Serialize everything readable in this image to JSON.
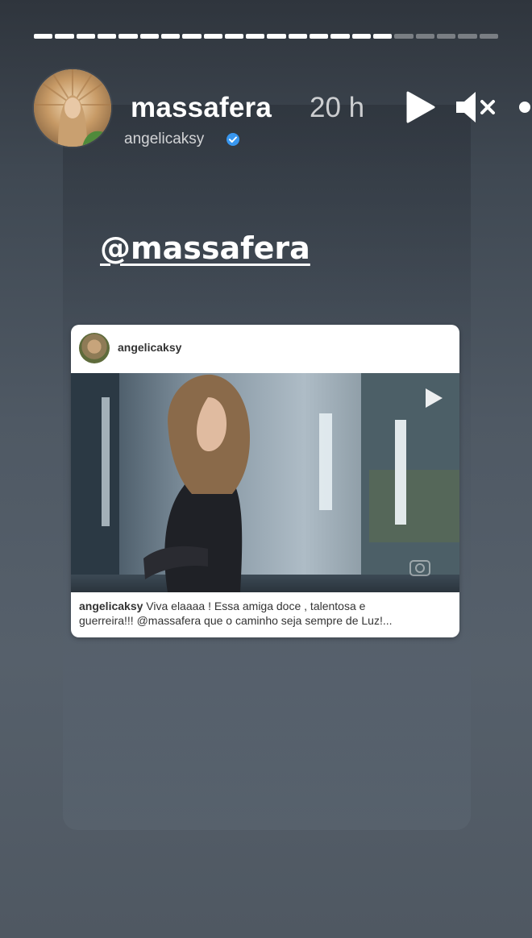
{
  "progress": {
    "segments": 22,
    "completed": 17
  },
  "header": {
    "username": "massafera",
    "time": "20 h",
    "sub_username": "angelicaksy",
    "icons": [
      "play-icon",
      "mute-icon",
      "more-icon",
      "verified-icon"
    ]
  },
  "story": {
    "mention": "@massafera"
  },
  "post": {
    "username": "angelicaksy",
    "caption_user": "angelicaksy",
    "caption_line1": "Viva elaaaa ! Essa amiga doce , talentosa e",
    "caption_line2": "guerreira!!! @massafera que o caminho seja sempre de Luz!..."
  },
  "colors": {
    "background_top": "#2f353d",
    "background_bottom": "#56606b",
    "verified": "#3897f0",
    "text": "#ffffff"
  }
}
